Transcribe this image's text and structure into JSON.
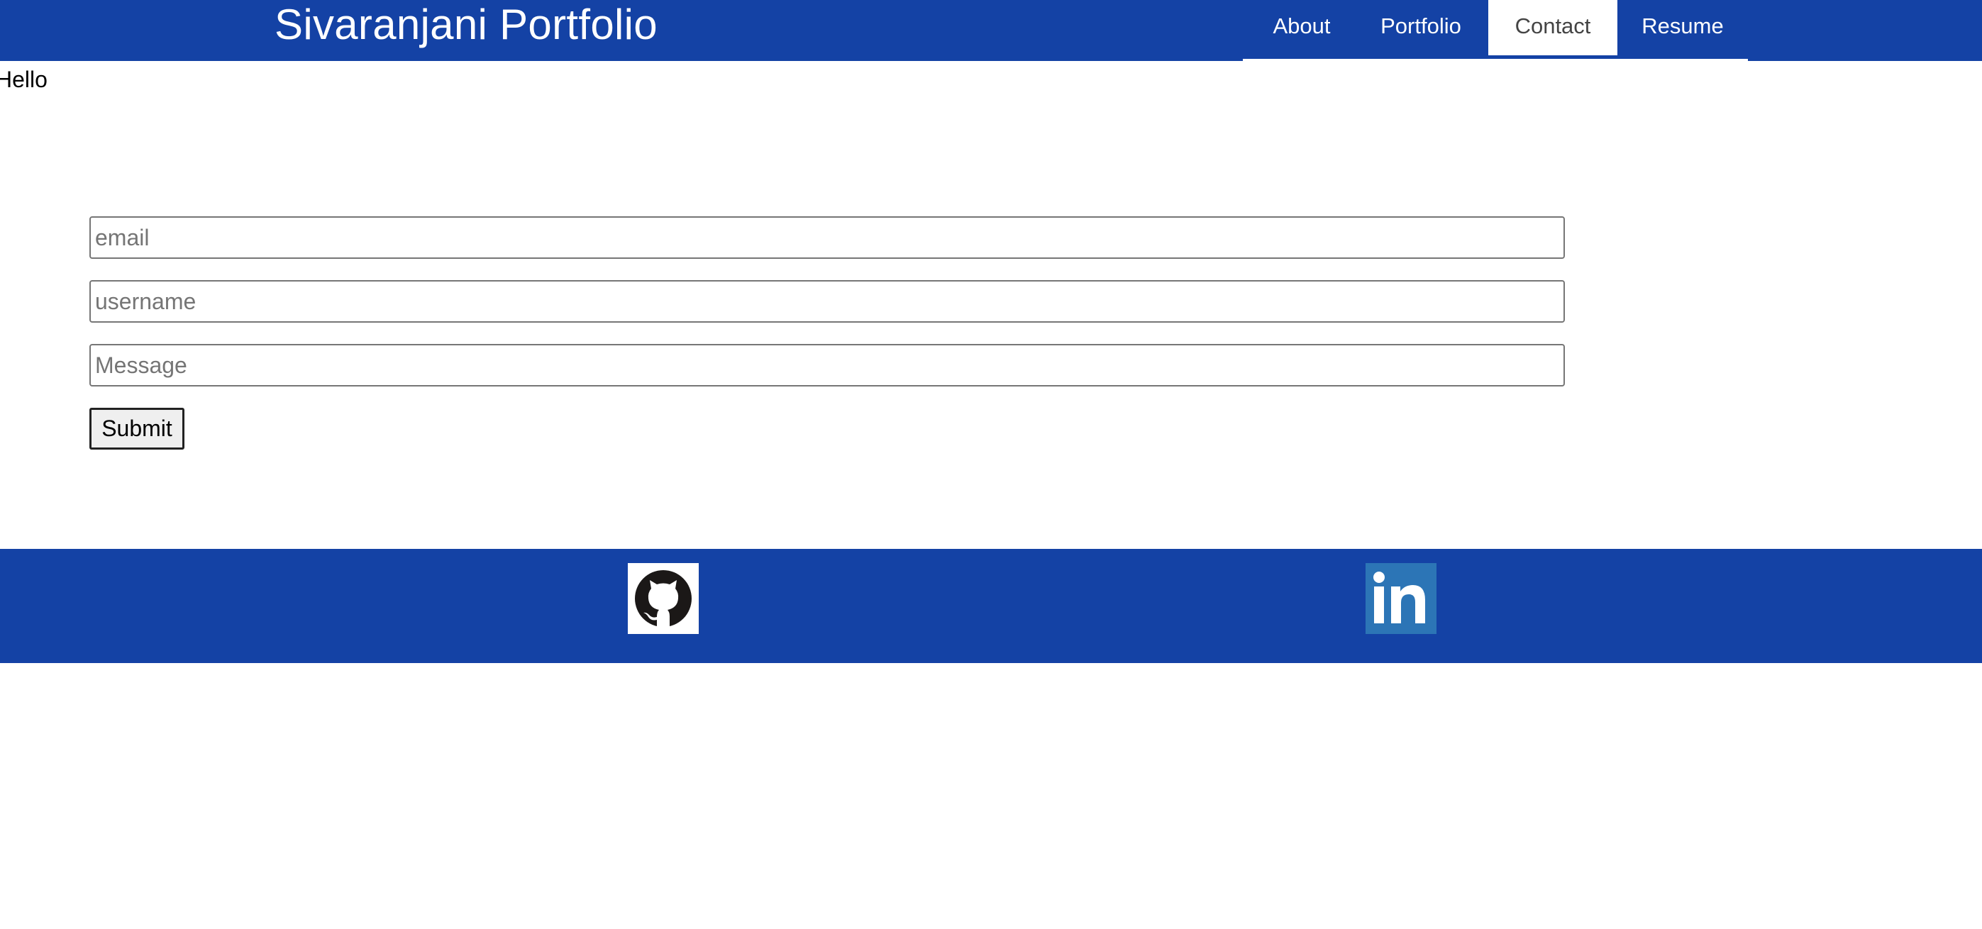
{
  "header": {
    "brand": "Sivaranjani Portfolio",
    "nav": [
      {
        "label": "About",
        "active": false
      },
      {
        "label": "Portfolio",
        "active": false
      },
      {
        "label": "Contact",
        "active": true
      },
      {
        "label": "Resume",
        "active": false
      }
    ]
  },
  "main": {
    "greeting": "Hello",
    "form": {
      "email_placeholder": "email",
      "email_value": "",
      "username_placeholder": "username",
      "username_value": "",
      "message_placeholder": "Message",
      "message_value": "",
      "submit_label": "Submit"
    }
  },
  "footer": {
    "links": [
      {
        "icon": "github-icon"
      },
      {
        "icon": "linkedin-icon"
      }
    ]
  },
  "colors": {
    "primary": "#1442a5",
    "white": "#ffffff",
    "linkedin": "#2c75b6",
    "github": "#1b1817"
  }
}
